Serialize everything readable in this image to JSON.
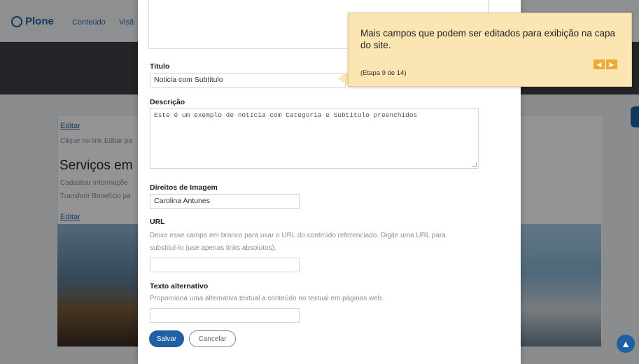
{
  "site": {
    "logo": "Plone",
    "nav": [
      "Conteúdo",
      "Visã"
    ]
  },
  "background": {
    "edit_label_1": "Editar",
    "edit_hint": "Clique no link Editar pa",
    "section_title": "Serviços em",
    "line_1": "Cadastrar Informaçõe",
    "line_2": "Transferir Benefício pa",
    "edit_label_2": "Editar"
  },
  "form": {
    "title": {
      "label": "Titulo",
      "value": "Noticia com Subtitulo"
    },
    "description": {
      "label": "Descrição",
      "value": "Este é um exemplo de notícia com Categoria e Subtitulo preenchidos"
    },
    "image_rights": {
      "label": "Direitos de Imagem",
      "value": "Carolina Antunes"
    },
    "url": {
      "label": "URL",
      "help_1": "Deixe esse campo em branco para usar o URL do conteúdo referenciado. Digite uma URL para",
      "help_2": "substituí-lo (use apenas links absolutos).",
      "value": ""
    },
    "alt_text": {
      "label": "Texto alternativo",
      "help": "Proporciona uma alternativa textual a conteúdo no textual em páginas web.",
      "value": ""
    },
    "buttons": {
      "save": "Salvar",
      "cancel": "Cancelar"
    }
  },
  "tour_tip": {
    "text": "Mais campos que podem ser editados para exibição na capa do site.",
    "step": "(Etapa 9 de 14)",
    "prev_icon": "chevron-left",
    "next_icon": "chevron-right"
  },
  "colors": {
    "accent": "#1f5fa5",
    "tip_bg": "#fbe6b3",
    "tip_btn": "#f0a830"
  }
}
